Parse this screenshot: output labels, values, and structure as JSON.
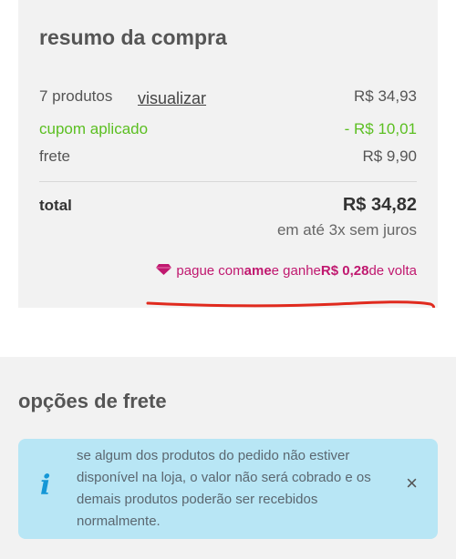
{
  "summary": {
    "title": "resumo da compra",
    "products_label": "7 produtos",
    "view_link": "visualizar",
    "products_value": "R$ 34,93",
    "coupon_label": "cupom aplicado",
    "coupon_value": "- R$ 10,01",
    "shipping_label": "frete",
    "shipping_value": "R$ 9,90",
    "total_label": "total",
    "total_value": "R$ 34,82",
    "installments": "em até 3x sem juros",
    "ame": {
      "prefix": "pague com ",
      "brand": "ame",
      "middle": " e ganhe ",
      "amount": "R$ 0,28",
      "suffix": " de volta",
      "icon": "gem-icon",
      "color": "#c0186f"
    }
  },
  "options": {
    "title": "opções de frete",
    "alert": {
      "icon": "info-icon",
      "text": "se algum dos produtos do pedido não estiver disponível na loja, o valor não será cobrado e os demais produtos poderão ser recebidos normalmente.",
      "close": "×"
    }
  },
  "colors": {
    "accent_green": "#5bbf21",
    "ame_pink": "#c0186f",
    "alert_bg": "#b8e6f5",
    "info_blue": "#1597d6",
    "annotation_red": "#e02a1e"
  }
}
